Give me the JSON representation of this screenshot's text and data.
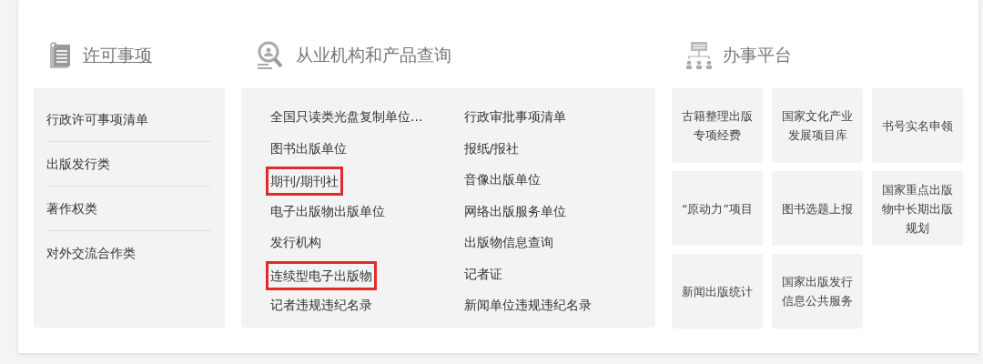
{
  "sections": [
    {
      "title": "许可事项",
      "title_link": true,
      "kind": "list",
      "items": [
        "行政许可事项清单",
        "出版发行类",
        "著作权类",
        "对外交流合作类"
      ]
    },
    {
      "title": "从业机构和产品查询",
      "title_link": false,
      "kind": "links",
      "columns": [
        [
          {
            "label": "全国只读类光盘复制单位...",
            "highlighted": false
          },
          {
            "label": "图书出版单位",
            "highlighted": false
          },
          {
            "label": "期刊/期刊社",
            "highlighted": true
          },
          {
            "label": "电子出版物出版单位",
            "highlighted": false
          },
          {
            "label": "发行机构",
            "highlighted": false
          },
          {
            "label": "连续型电子出版物",
            "highlighted": true
          },
          {
            "label": "记者违规违纪名录",
            "highlighted": false
          }
        ],
        [
          {
            "label": "行政审批事项清单",
            "highlighted": false
          },
          {
            "label": "报纸/报社",
            "highlighted": false
          },
          {
            "label": "音像出版单位",
            "highlighted": false
          },
          {
            "label": "网络出版服务单位",
            "highlighted": false
          },
          {
            "label": "出版物信息查询",
            "highlighted": false
          },
          {
            "label": "记者证",
            "highlighted": false
          },
          {
            "label": "新闻单位违规违纪名录",
            "highlighted": false
          }
        ]
      ]
    },
    {
      "title": "办事平台",
      "title_link": false,
      "kind": "tiles",
      "tiles": [
        "古籍整理出版专项经费",
        "国家文化产业发展项目库",
        "书号实名申领",
        "“原动力”项目",
        "图书选题上报",
        "国家重点出版物中长期出版规划",
        "新闻出版统计",
        "国家出版发行信息公共服务"
      ]
    }
  ]
}
